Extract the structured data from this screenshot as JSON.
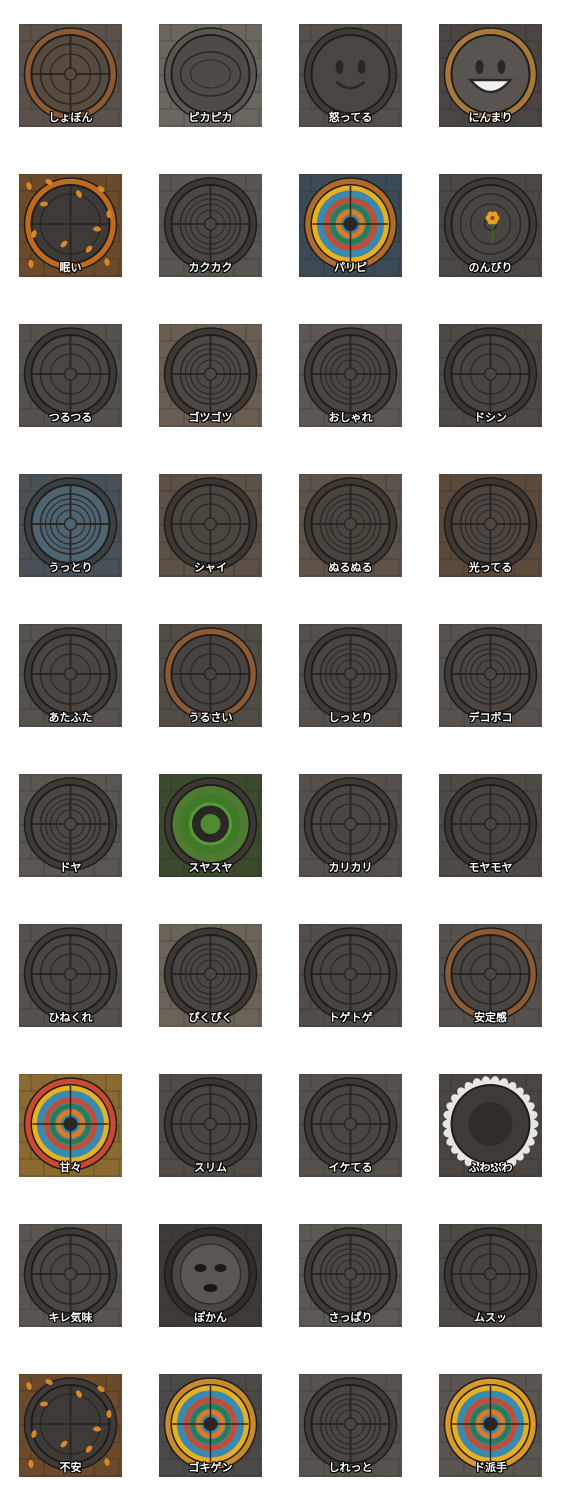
{
  "stickers": [
    {
      "label": "しょぼん",
      "bg": "#5a524a",
      "rim": "#8a5a34",
      "cover": "#574a3f",
      "style": "cross"
    },
    {
      "label": "ピカピカ",
      "bg": "#6b6660",
      "rim": "#5a554f",
      "cover": "#4f4a45",
      "style": "plain"
    },
    {
      "label": "怒ってる",
      "bg": "#55504b",
      "rim": "#3f3a36",
      "cover": "#4a4540",
      "style": "face-smile"
    },
    {
      "label": "にんまり",
      "bg": "#4a4542",
      "rim": "#a8773c",
      "cover": "#5a5450",
      "style": "face-grin"
    },
    {
      "label": "眠い",
      "bg": "#6a4a2a",
      "rim": "#c06a20",
      "cover": "#3e3a37",
      "style": "leaves"
    },
    {
      "label": "カクカク",
      "bg": "#5a5550",
      "rim": "#3c3835",
      "cover": "#4b4642",
      "style": "maze"
    },
    {
      "label": "パリピ",
      "bg": "#3b4a55",
      "rim": "#b06a2a",
      "cover": "#3a86a0",
      "style": "colorful"
    },
    {
      "label": "のんびり",
      "bg": "#4b4744",
      "rim": "#3e3a37",
      "cover": "#484441",
      "style": "flower"
    },
    {
      "label": "つるつる",
      "bg": "#55514d",
      "rim": "#3b3835",
      "cover": "#4a4643",
      "style": "cross"
    },
    {
      "label": "ゴツゴツ",
      "bg": "#6a5e52",
      "rim": "#3e3935",
      "cover": "#4d4843",
      "style": "maze"
    },
    {
      "label": "おしゃれ",
      "bg": "#5c5752",
      "rim": "#3f3b37",
      "cover": "#4a4541",
      "style": "maze"
    },
    {
      "label": "ドシン",
      "bg": "#4d4945",
      "rim": "#3a3633",
      "cover": "#494440",
      "style": "cross"
    },
    {
      "label": "うっとり",
      "bg": "#4a5156",
      "rim": "#3a3f43",
      "cover": "#4d6470",
      "style": "maze"
    },
    {
      "label": "シャイ",
      "bg": "#5b5147",
      "rim": "#3d3732",
      "cover": "#4b4540",
      "style": "cross"
    },
    {
      "label": "ぬるぬる",
      "bg": "#5d534a",
      "rim": "#3f3933",
      "cover": "#4a443f",
      "style": "maze"
    },
    {
      "label": "光ってる",
      "bg": "#5a4a3c",
      "rim": "#3f3630",
      "cover": "#4c4540",
      "style": "maze"
    },
    {
      "label": "あたふた",
      "bg": "#56524e",
      "rim": "#3e3a36",
      "cover": "#4a4541",
      "style": "cross"
    },
    {
      "label": "うるさい",
      "bg": "#524c46",
      "rim": "#8a5a34",
      "cover": "#474340",
      "style": "cross"
    },
    {
      "label": "しっとり",
      "bg": "#55504c",
      "rim": "#3d3936",
      "cover": "#494541",
      "style": "maze"
    },
    {
      "label": "デコボコ",
      "bg": "#57524d",
      "rim": "#3f3b37",
      "cover": "#4b4642",
      "style": "maze"
    },
    {
      "label": "ドヤ",
      "bg": "#5a5651",
      "rim": "#3e3a36",
      "cover": "#4a4642",
      "style": "maze"
    },
    {
      "label": "スヤスヤ",
      "bg": "#3c4a2c",
      "rim": "#3b3835",
      "cover": "#4f7a32",
      "style": "moss"
    },
    {
      "label": "カリカリ",
      "bg": "#55504b",
      "rim": "#3e3a36",
      "cover": "#4b4642",
      "style": "cross"
    },
    {
      "label": "モヤモヤ",
      "bg": "#4e4a46",
      "rim": "#3a3633",
      "cover": "#474340",
      "style": "cross"
    },
    {
      "label": "ひねくれ",
      "bg": "#56514c",
      "rim": "#3e3a36",
      "cover": "#4a4541",
      "style": "cross"
    },
    {
      "label": "ぴくぴく",
      "bg": "#6b6358",
      "rim": "#3c3834",
      "cover": "#4a4540",
      "style": "maze"
    },
    {
      "label": "トゲトゲ",
      "bg": "#524d48",
      "rim": "#3d3935",
      "cover": "#484440",
      "style": "cross"
    },
    {
      "label": "安定感",
      "bg": "#56514c",
      "rim": "#8a5a34",
      "cover": "#4a4541",
      "style": "cross"
    },
    {
      "label": "甘々",
      "bg": "#8a6a30",
      "rim": "#c84a32",
      "cover": "#2f8fb0",
      "style": "colorful"
    },
    {
      "label": "スリム",
      "bg": "#504b47",
      "rim": "#3b3734",
      "cover": "#484440",
      "style": "cross"
    },
    {
      "label": "イケてる",
      "bg": "#55504b",
      "rim": "#3d3935",
      "cover": "#4a4541",
      "style": "cross"
    },
    {
      "label": "ふわふわ",
      "bg": "#4a4541",
      "rim": "#e8e6e0",
      "cover": "#3e3a37",
      "style": "fluffy"
    },
    {
      "label": "キレ気味",
      "bg": "#5a5550",
      "rim": "#3d3936",
      "cover": "#4b4642",
      "style": "cross"
    },
    {
      "label": "ぽかん",
      "bg": "#3e3a37",
      "rim": "#2f2c2a",
      "cover": "#4a4643",
      "style": "face-moon"
    },
    {
      "label": "さっぱり",
      "bg": "#5c5853",
      "rim": "#3e3a36",
      "cover": "#4a4642",
      "style": "maze"
    },
    {
      "label": "ムスッ",
      "bg": "#4d4945",
      "rim": "#3a3633",
      "cover": "#474340",
      "style": "cross"
    },
    {
      "label": "不安",
      "bg": "#6a4a2a",
      "rim": "#3e3a37",
      "cover": "#3e3a37",
      "style": "leaves"
    },
    {
      "label": "ゴキゲン",
      "bg": "#4b4a48",
      "rim": "#c88a2a",
      "cover": "#3a8ab0",
      "style": "colorful"
    },
    {
      "label": "しれっと",
      "bg": "#57524d",
      "rim": "#3e3a36",
      "cover": "#4a4541",
      "style": "maze"
    },
    {
      "label": "ド派手",
      "bg": "#5a5550",
      "rim": "#d89a2a",
      "cover": "#3a8ab0",
      "style": "colorful"
    }
  ]
}
